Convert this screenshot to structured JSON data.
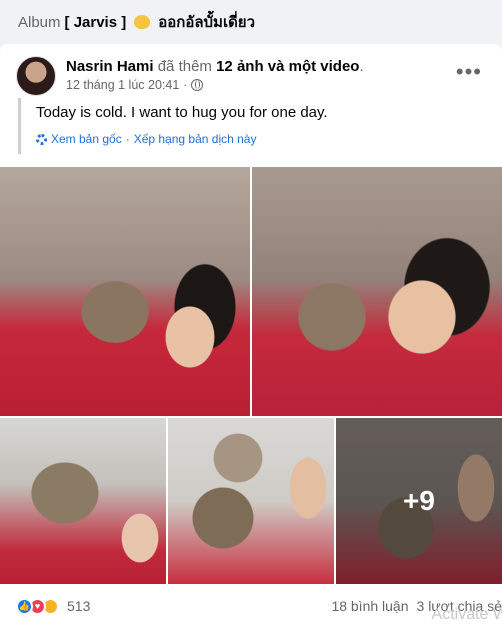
{
  "album": {
    "prefix": "Album",
    "name": "[ Jarvis ]",
    "suffix": "ออกอัลบั้มเดี่ยว"
  },
  "post": {
    "author": "Nasrin Hami",
    "action_plain": " đã thêm ",
    "action_bold": "12 ảnh và một video",
    "action_end": ".",
    "timestamp": "12 tháng 1 lúc 20:41",
    "separator": "·",
    "text": "Today is cold. I want to hug you for one day.",
    "see_original": "Xem bản gốc",
    "dot": "·",
    "rate_translation": "Xếp hạng bản dịch này",
    "more_icon": "•••"
  },
  "media": {
    "extra_count": "+9"
  },
  "footer": {
    "reaction_count": "513",
    "comments": "18 bình luận",
    "shares": "3 lượt chia sẻ"
  },
  "watermark": "Activate W"
}
